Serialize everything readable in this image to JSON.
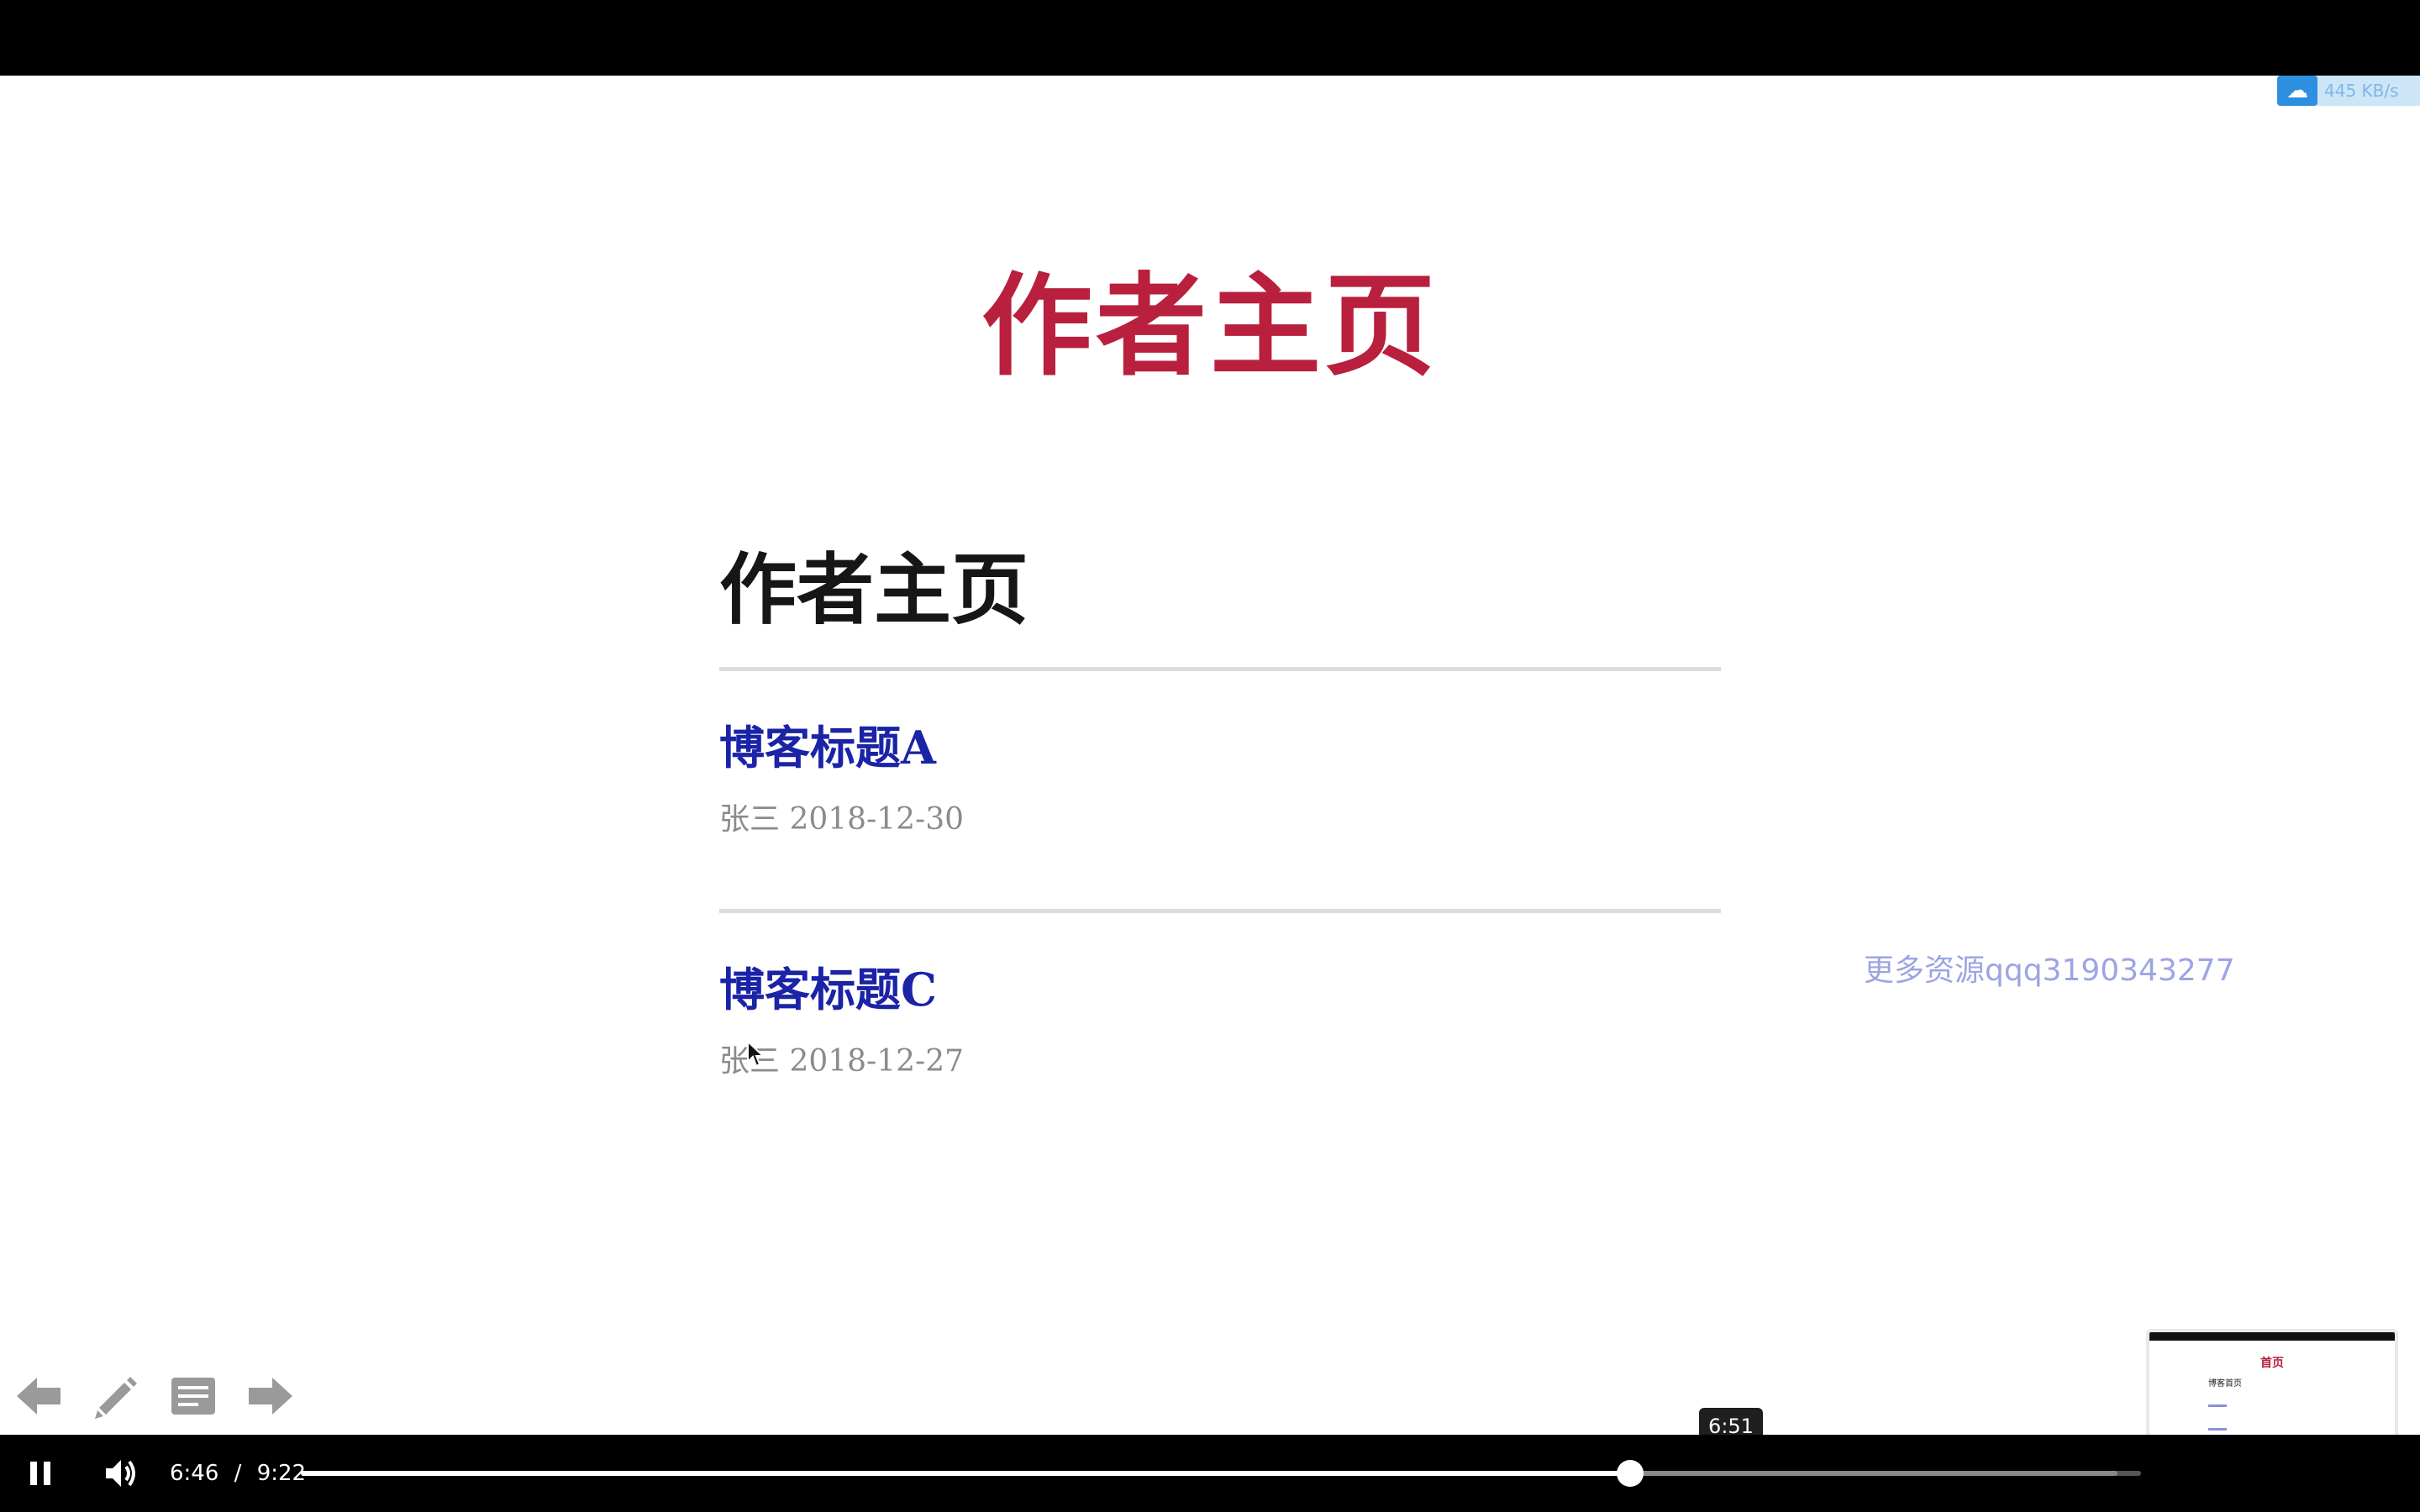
{
  "slide": {
    "title": "作者主页"
  },
  "page": {
    "heading": "作者主页",
    "posts": [
      {
        "title": "博客标题A",
        "meta": "张三 2018-12-30"
      },
      {
        "title": "博客标题C",
        "meta": "张三 2018-12-27"
      }
    ]
  },
  "watermark": "更多资源qqq3190343277",
  "speed_badge": {
    "text": "445 KB/s",
    "icon": "cloud-icon"
  },
  "slide_tools": [
    {
      "name": "prev-arrow-icon"
    },
    {
      "name": "pencil-icon"
    },
    {
      "name": "notes-icon"
    },
    {
      "name": "next-arrow-icon"
    }
  ],
  "thumbnail": {
    "title": "首页",
    "heading": "博客首页"
  },
  "tooltip_time": "6:51",
  "player": {
    "current_time": "6:46",
    "separator": "/",
    "duration": "9:22",
    "played_fraction": 0.7224,
    "buffered_fraction": 0.9872,
    "hover_fraction": 0.7313
  },
  "colors": {
    "slide_title": "#b8203d",
    "link": "#1b23a6",
    "meta": "#8b8b8b",
    "watermark": "#8b95e0"
  }
}
